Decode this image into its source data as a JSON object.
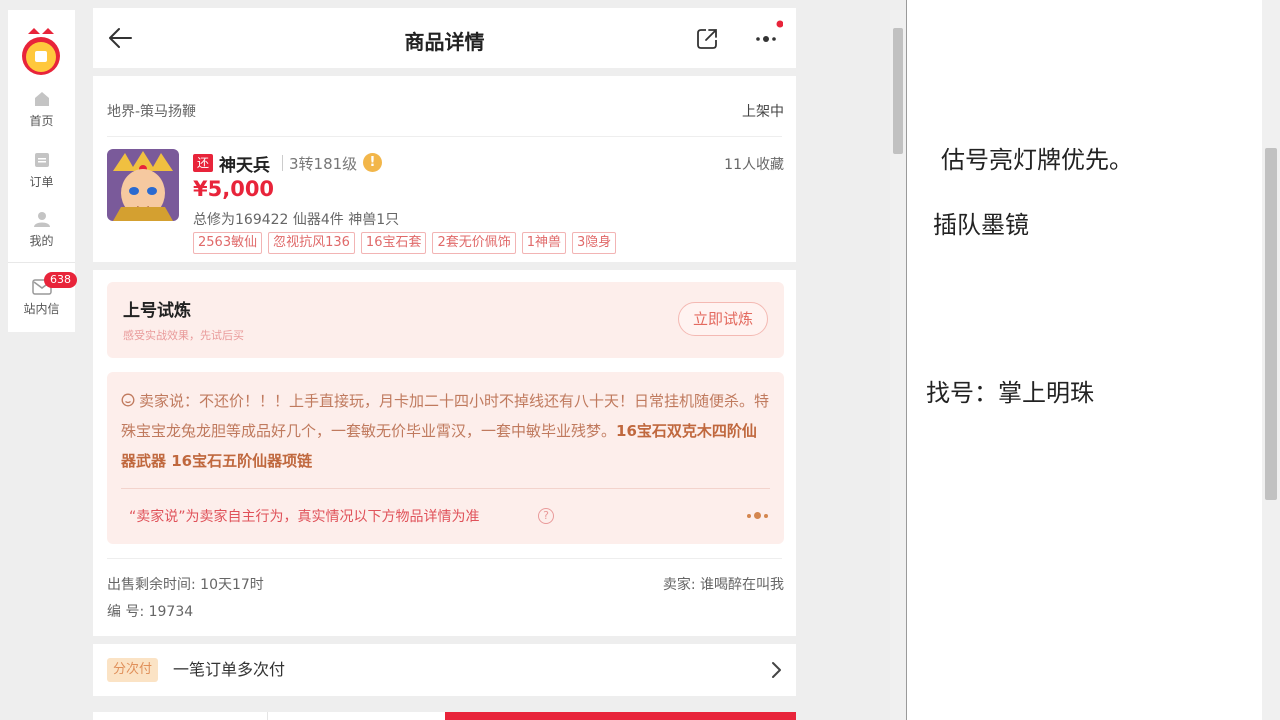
{
  "sidebar": {
    "logo": "bell-logo",
    "items": [
      {
        "label": "首页",
        "icon": "home-icon"
      },
      {
        "label": "订单",
        "icon": "order-icon"
      },
      {
        "label": "我的",
        "icon": "user-icon"
      },
      {
        "label": "站内信",
        "icon": "mail-icon",
        "badge": "638"
      }
    ]
  },
  "header": {
    "title": "商品详情",
    "back_icon": "back-arrow-icon",
    "share_icon": "share-icon",
    "more_icon": "more-icon"
  },
  "item": {
    "server": "地界-策马扬鞭",
    "status": "上架中",
    "bargain_badge": "还",
    "role": "神天兵",
    "level": "3转181级",
    "warn_glyph": "!",
    "favorites": "11人收藏",
    "price": "¥5,000",
    "stats": "总修为169422  仙器4件  神兽1只",
    "tags": [
      "2563敏仙",
      "忽视抗风136",
      "16宝石套",
      "2套无价佩饰",
      "1神兽",
      "3隐身"
    ]
  },
  "trial": {
    "title": "上号试炼",
    "subtitle": "感受实战效果，先试后买",
    "button": "立即试炼"
  },
  "seller_note": {
    "text": "卖家说：不还价！！！上手直接玩，月卡加二十四小时不掉线还有八十天！日常挂机随便杀。特殊宝宝龙兔龙胆等成品好几个，一套敏无价毕业霄汉，一套中敏毕业残梦。",
    "bold_text": "16宝石双克木四阶仙器武器 16宝石五阶仙器项链",
    "disclaimer": "“卖家说”为卖家自主行为，真实情况以下方物品详情为准",
    "help_glyph": "?"
  },
  "meta": {
    "remaining": "出售剩余时间: 10天17时",
    "seller": "卖家: 谁喝醉在叫我",
    "id": "编 号: 19734"
  },
  "installment": {
    "badge": "分次付",
    "text": "一笔订单多次付"
  },
  "notes": [
    "估号亮灯牌优先。",
    "插队墨镜",
    "找号：掌上明珠"
  ],
  "colors": {
    "accent": "#e8243a",
    "tag_border": "#f2b4b4",
    "note_bg": "#fdeeeb",
    "seller_text": "#c07a5e"
  }
}
